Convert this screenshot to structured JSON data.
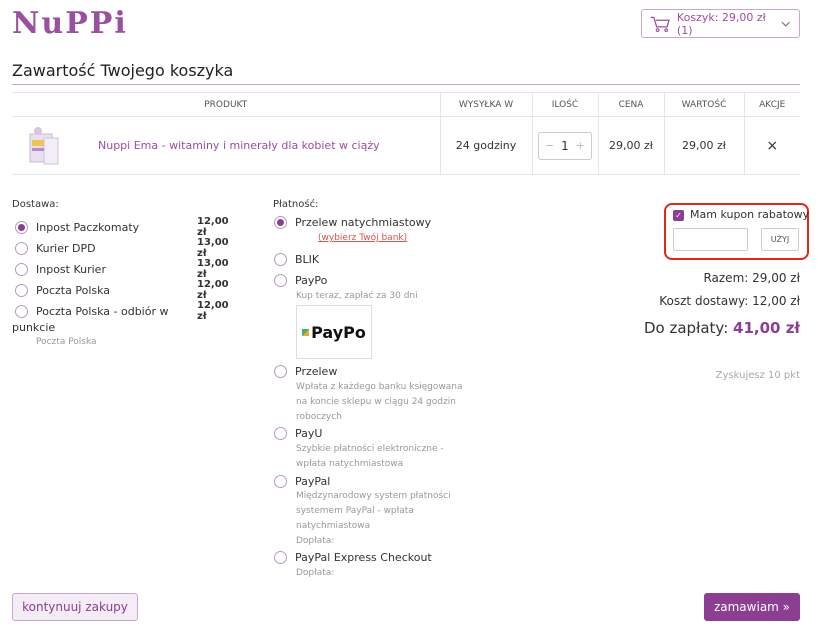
{
  "brand": {
    "logo_text": "NuPPi",
    "accent": "#8b3e92"
  },
  "header": {
    "cart_label": "Koszyk: 29,00 zł (1)"
  },
  "page_title": "Zawartość Twojego koszyka",
  "table": {
    "columns": [
      "PRODUKT",
      "WYSYŁKA W",
      "ILOŚĆ",
      "CENA",
      "WARTOŚĆ",
      "AKCJE"
    ],
    "rows": [
      {
        "name": "Nuppi Ema - witaminy i minerały dla kobiet w ciąży",
        "shipping": "24 godziny",
        "qty": "1",
        "price": "29,00 zł",
        "value": "29,00 zł",
        "qty_minus": "−",
        "qty_plus": "+",
        "remove": "×"
      }
    ]
  },
  "delivery": {
    "label": "Dostawa:",
    "options": [
      {
        "label": "Inpost Paczkomaty",
        "price": "12,00 zł",
        "selected": true
      },
      {
        "label": "Kurier DPD",
        "price": "13,00 zł"
      },
      {
        "label": "Inpost Kurier",
        "price": "13,00 zł"
      },
      {
        "label": "Poczta Polska",
        "price": "12,00 zł"
      },
      {
        "label": "Poczta Polska - odbiór w",
        "label_cont": "punkcie",
        "price": "12,00 zł",
        "sub": "Poczta Polska"
      }
    ]
  },
  "payment": {
    "label": "Płatność:",
    "options": [
      {
        "label": "Przelew natychmiastowy",
        "link": "(wybierz Twój bank)",
        "selected": true
      },
      {
        "label": "BLIK"
      },
      {
        "label": "PayPo",
        "desc": "Kup teraz, zapłać za 30 dni",
        "logo_text": "PayPo"
      },
      {
        "label": "Przelew",
        "desc": [
          "Wpłata z każdego banku księgowana",
          "na koncie sklepu w ciągu 24 godzin",
          "roboczych"
        ]
      },
      {
        "label": "PayU",
        "desc": [
          "Szybkie płatności elektroniczne -",
          "wpłata natychmiastowa"
        ]
      },
      {
        "label": "PayPal",
        "desc": [
          "Międzynarodowy system płatności",
          "systemem PayPal - wpłata",
          "natychmiastowa",
          "Dopłata:"
        ]
      },
      {
        "label": "PayPal Express Checkout",
        "desc": [
          "Dopłata:"
        ]
      }
    ]
  },
  "coupon": {
    "label": "Mam kupon rabatowy",
    "checked": true,
    "input_value": "",
    "button": "UŻYJ"
  },
  "summary": {
    "subtotal": "Razem: 29,00 zł",
    "shipping": "Koszt dostawy: 12,00 zł",
    "total_label": "Do zapłaty:",
    "total_value": "41,00 zł",
    "points": "Zyskujesz 10 pkt"
  },
  "actions": {
    "continue": "kontynuuj zakupy",
    "order": "zamawiam »"
  }
}
